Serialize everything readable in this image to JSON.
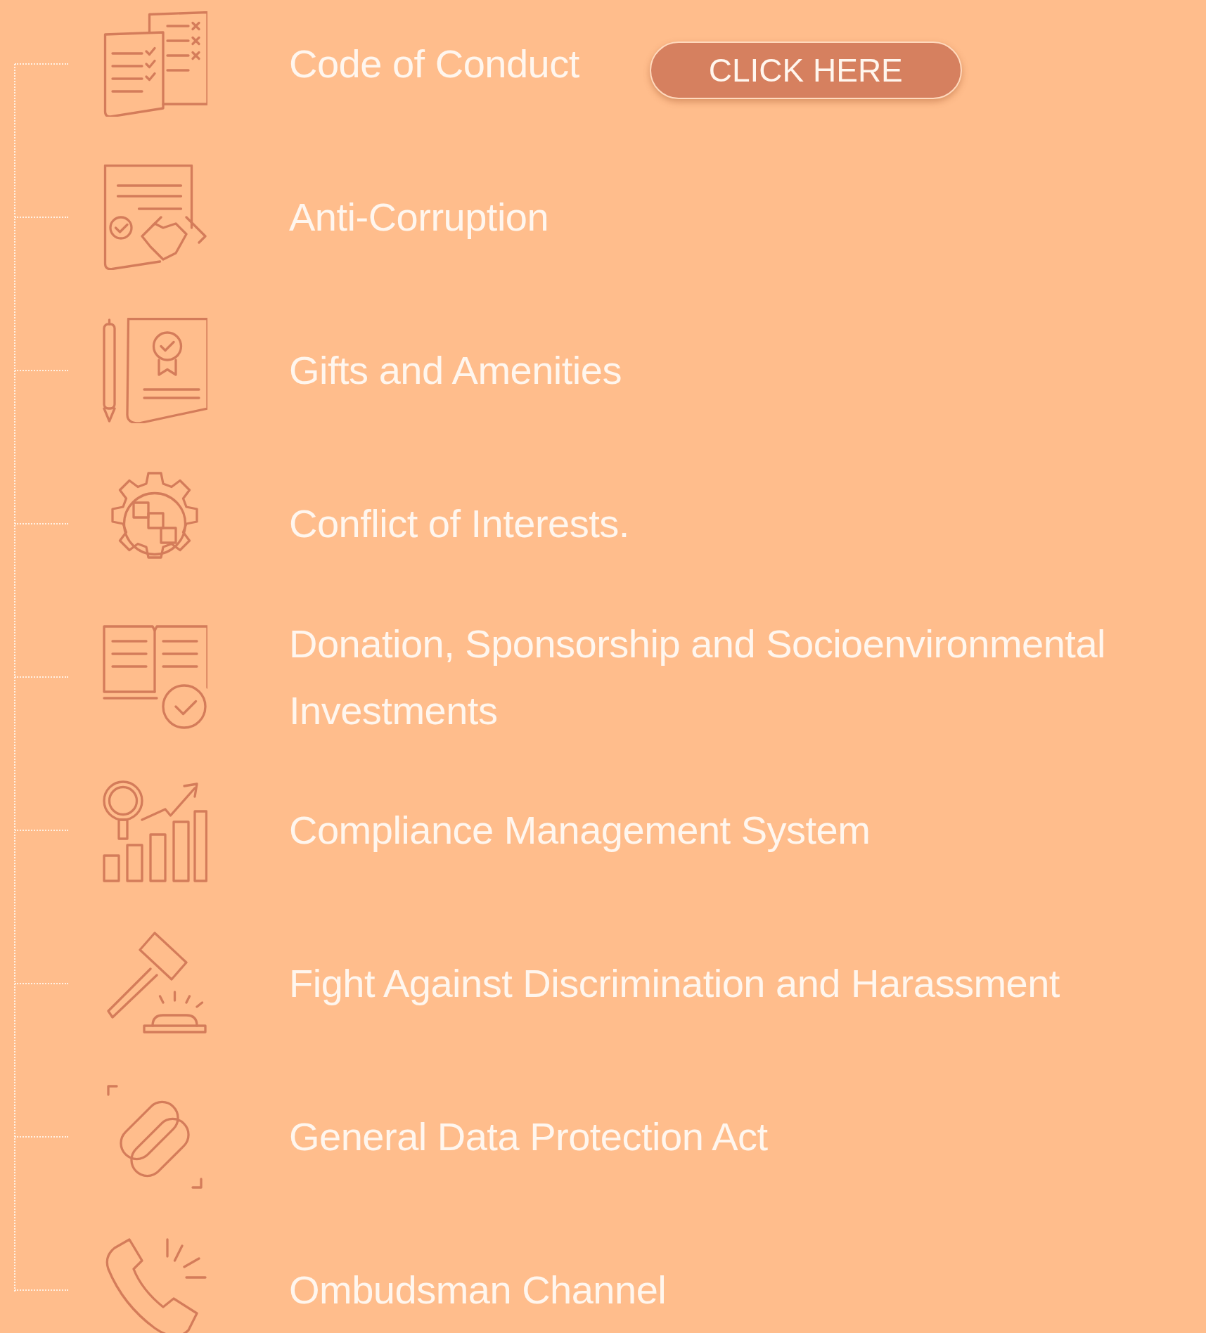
{
  "items": [
    {
      "label": "Code of Conduct",
      "button": "CLICK HERE"
    },
    {
      "label": "Anti-Corruption"
    },
    {
      "label": "Gifts and Amenities"
    },
    {
      "label": "Conflict of Interests."
    },
    {
      "label": "Donation, Sponsorship and Socioenvironmental Investments"
    },
    {
      "label": "Compliance Management System"
    },
    {
      "label": "Fight Against Discrimination and Harassment"
    },
    {
      "label": "General Data Protection Act"
    },
    {
      "label": "Ombudsman Channel"
    }
  ]
}
